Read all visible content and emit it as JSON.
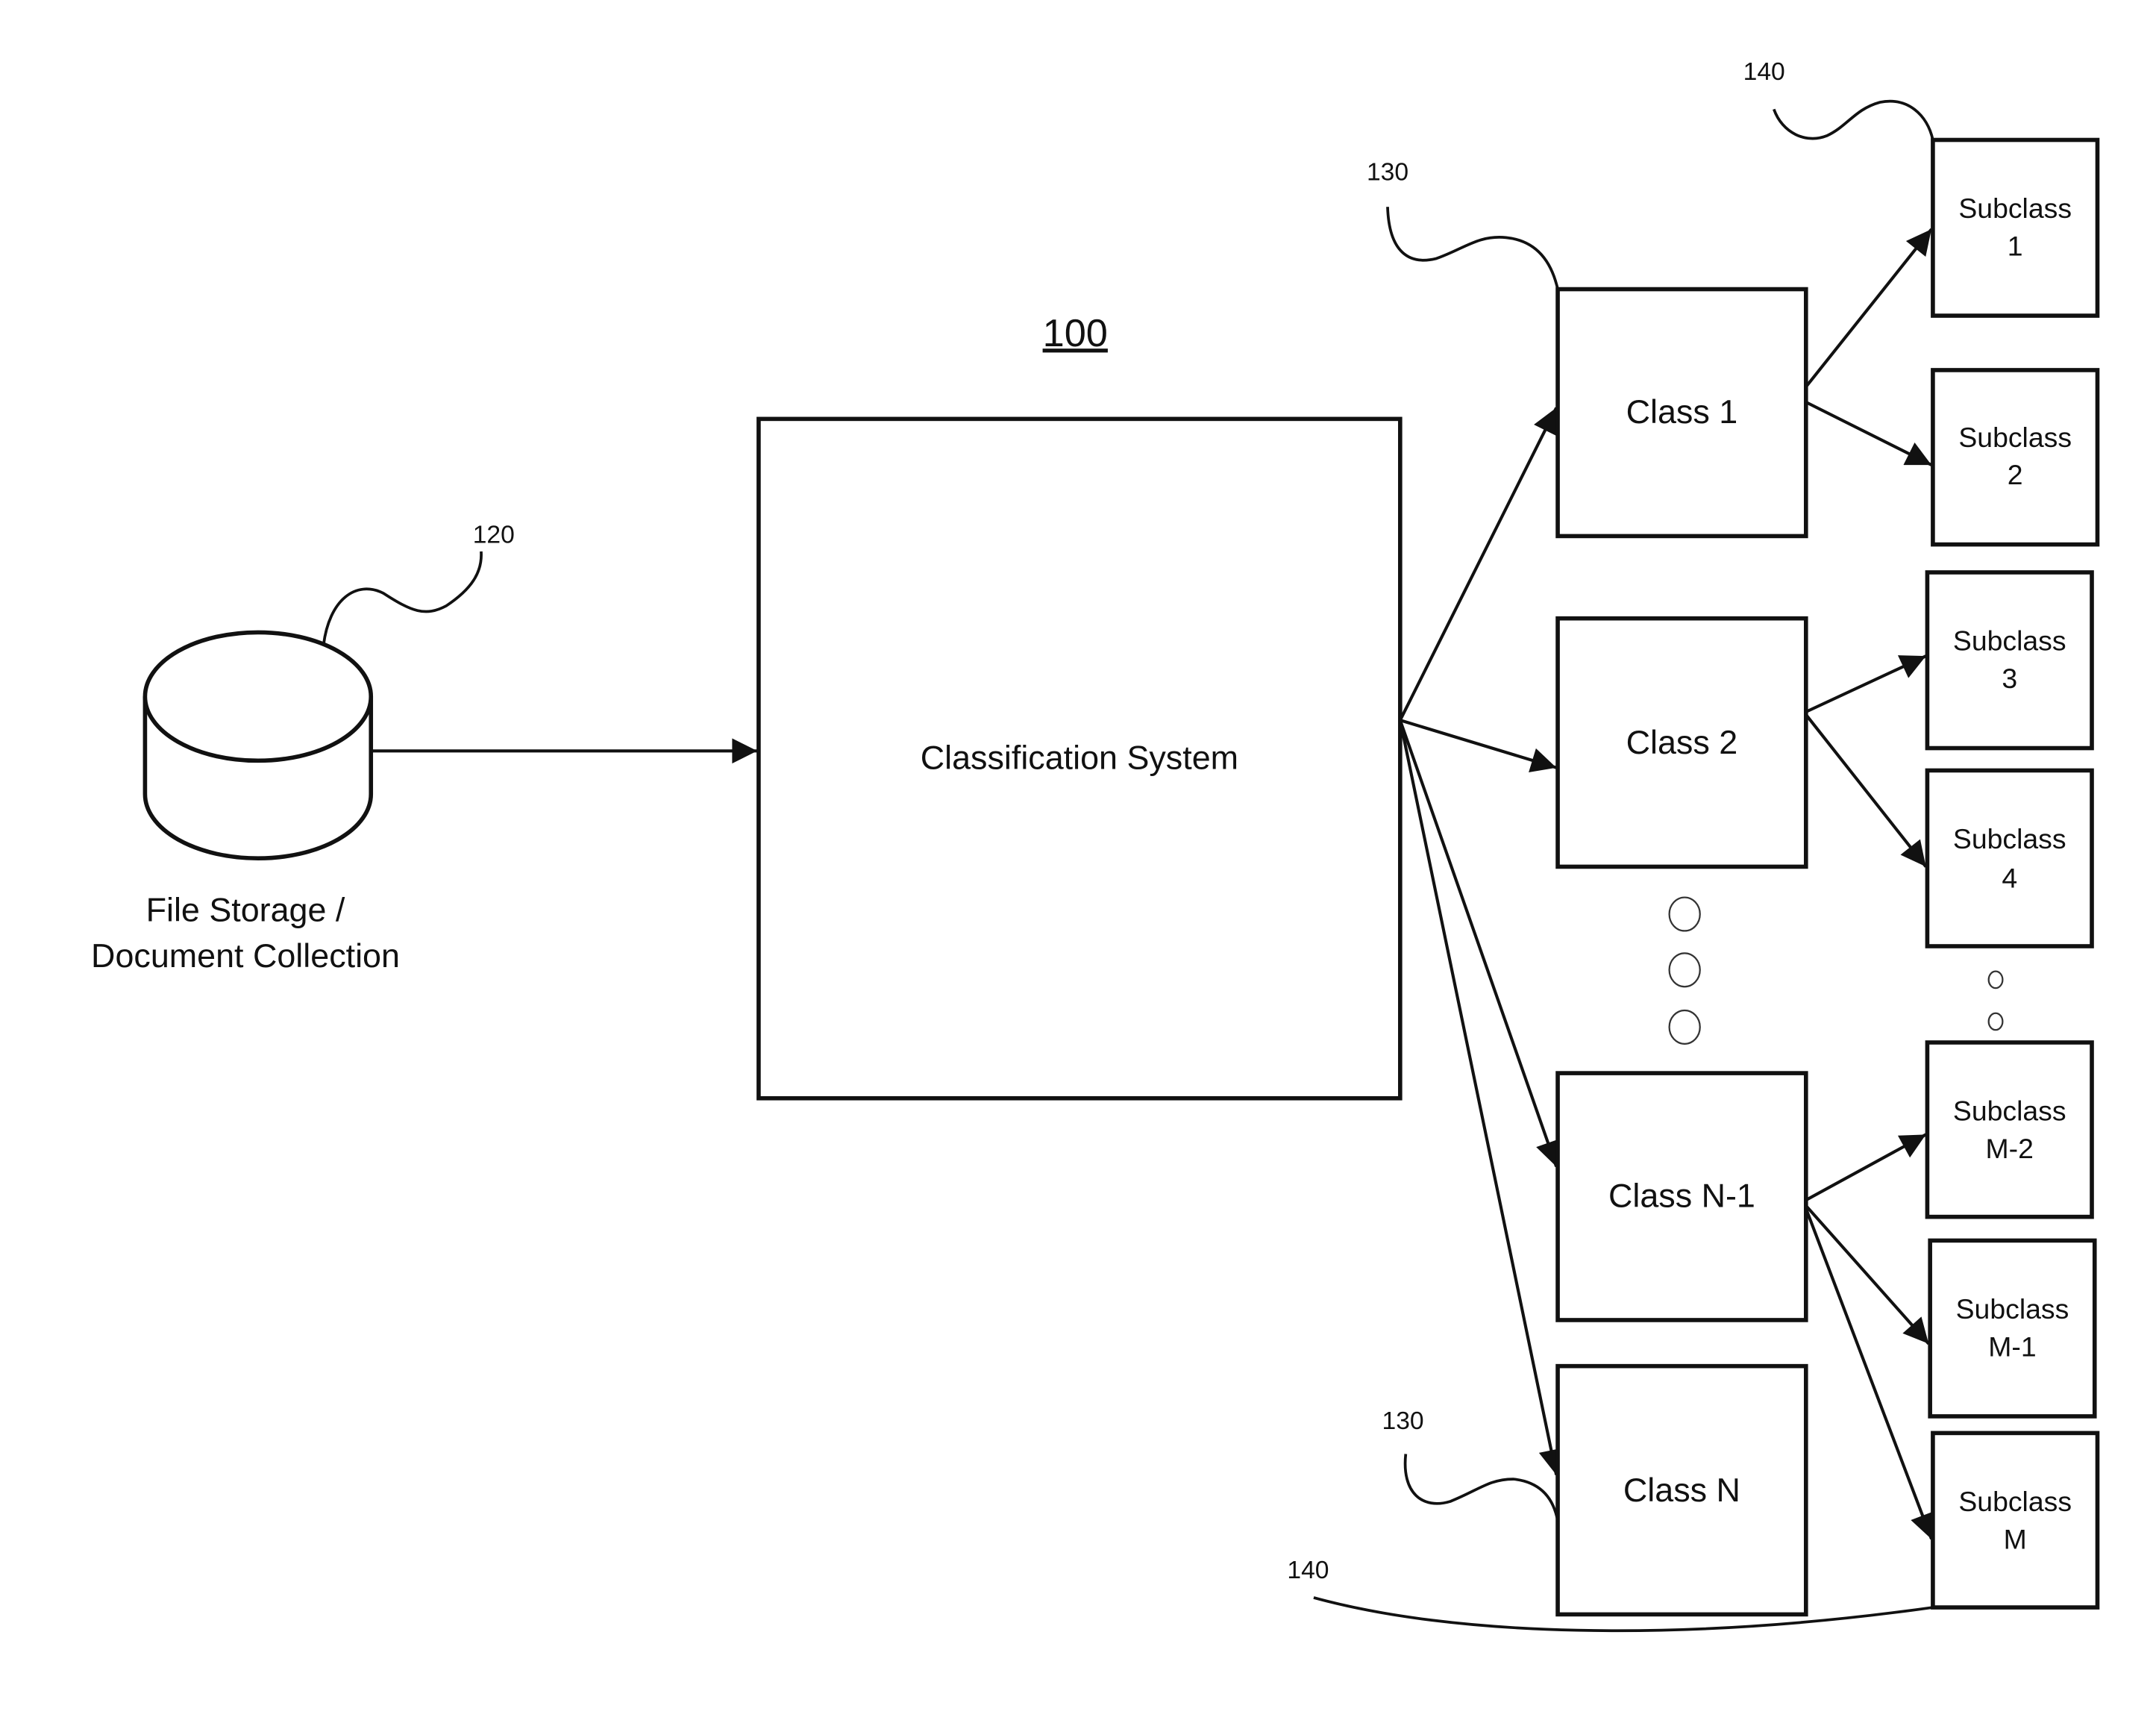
{
  "figure_number": "100",
  "data_source": {
    "label_line1": "File Storage /",
    "label_line2": "Document Collection",
    "ref": "120"
  },
  "classifier": {
    "label": "Classification System"
  },
  "class_ref_top": "130",
  "class_ref_bottom": "130",
  "subclass_ref_top": "140",
  "subclass_ref_bottom": "140",
  "classes": [
    {
      "label": "Class 1"
    },
    {
      "label": "Class 2"
    },
    {
      "label": "Class N-1"
    },
    {
      "label": "Class N"
    }
  ],
  "subclasses": [
    {
      "line1": "Subclass",
      "line2": "1"
    },
    {
      "line1": "Subclass",
      "line2": "2"
    },
    {
      "line1": "Subclass",
      "line2": "3"
    },
    {
      "line1": "Subclass",
      "line2": "4"
    },
    {
      "line1": "Subclass",
      "line2": "M-2"
    },
    {
      "line1": "Subclass",
      "line2": "M-1"
    },
    {
      "line1": "Subclass",
      "line2": "M"
    }
  ],
  "edges": [
    {
      "from": "File Storage / Document Collection",
      "to": "Classification System"
    },
    {
      "from": "Classification System",
      "to": "Class 1"
    },
    {
      "from": "Classification System",
      "to": "Class 2"
    },
    {
      "from": "Classification System",
      "to": "Class N-1"
    },
    {
      "from": "Classification System",
      "to": "Class N"
    },
    {
      "from": "Class 1",
      "to": "Subclass 1"
    },
    {
      "from": "Class 1",
      "to": "Subclass 2"
    },
    {
      "from": "Class 2",
      "to": "Subclass 3"
    },
    {
      "from": "Class 2",
      "to": "Subclass 4"
    },
    {
      "from": "Class N-1",
      "to": "Subclass M-2"
    },
    {
      "from": "Class N-1",
      "to": "Subclass M-1"
    },
    {
      "from": "Class N-1",
      "to": "Subclass M"
    }
  ]
}
